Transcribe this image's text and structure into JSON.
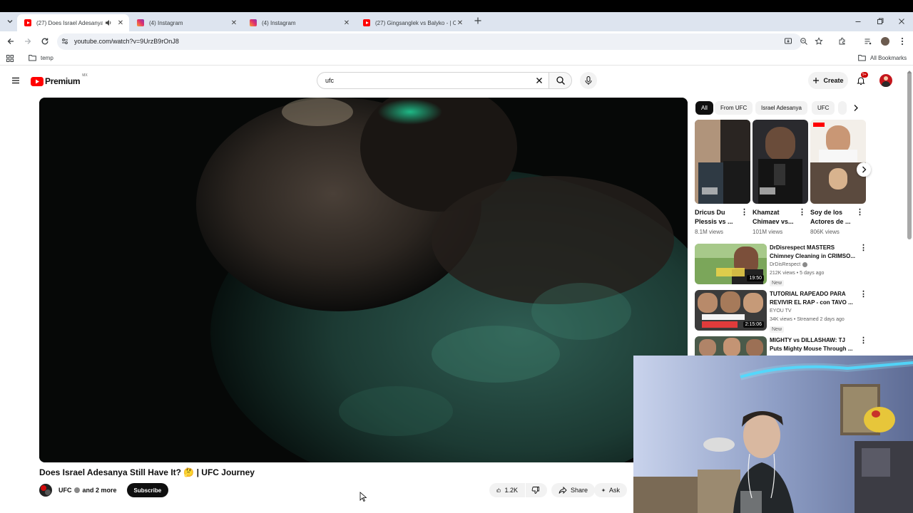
{
  "browser": {
    "tabs": [
      {
        "title": "(27) Does Israel Adesanya S",
        "favicon": "youtube-icon",
        "active": true
      },
      {
        "title": "(4) Instagram",
        "favicon": "instagram-icon",
        "active": false
      },
      {
        "title": "(4) Instagram",
        "favicon": "instagram-icon",
        "active": false
      },
      {
        "title": "(27) Gingsanglek vs Balyko - | C",
        "favicon": "youtube-icon",
        "active": false
      }
    ],
    "url": "youtube.com/watch?v=9UrzB9rOnJ8",
    "bookmarks": {
      "folder": "temp",
      "all_bookmarks": "All Bookmarks"
    }
  },
  "youtube": {
    "logo_text": "Premium",
    "region_badge": "MX",
    "search_value": "ufc",
    "create_label": "Create",
    "notification_badge": "9+",
    "video": {
      "title": "Does Israel Adesanya Still Have It? 🤔 | UFC Journey",
      "channel": "UFC",
      "and_more": "and 2 more",
      "subscribe_label": "Subscribe",
      "likes": "1.2K",
      "share_label": "Share",
      "ask_label": "Ask"
    },
    "chips": [
      "All",
      "From UFC",
      "Israel Adesanya",
      "UFC"
    ],
    "shorts": [
      {
        "title": "Dricus Du Plessis vs ...",
        "views": "8.1M views"
      },
      {
        "title": "Khamzat Chimaev vs...",
        "views": "101M views"
      },
      {
        "title": "Soy de los Actores de ...",
        "views": "806K views"
      }
    ],
    "recommended": [
      {
        "title": "DrDisrespect MASTERS Chimney Cleaning in CRIMSO...",
        "channel": "DrDisRespect",
        "meta": "212K views • 5 days ago",
        "badge": "New",
        "duration": "19:50"
      },
      {
        "title": "TUTORIAL RAPEADO PARA REVIVIR EL RAP - con TAVO ...",
        "channel": "EYOU TV",
        "meta": "34K views • Streamed 2 days ago",
        "badge": "New",
        "duration": "2:15:06"
      },
      {
        "title": "MIGHTY vs DILLASHAW: TJ Puts Mighty Mouse Through ...",
        "channel": "",
        "meta": "",
        "badge": "",
        "duration": ""
      }
    ]
  },
  "colors": {
    "youtube_red": "#ff0000",
    "tabstrip": "#dde4ef",
    "chip_bg": "#f2f2f2"
  }
}
